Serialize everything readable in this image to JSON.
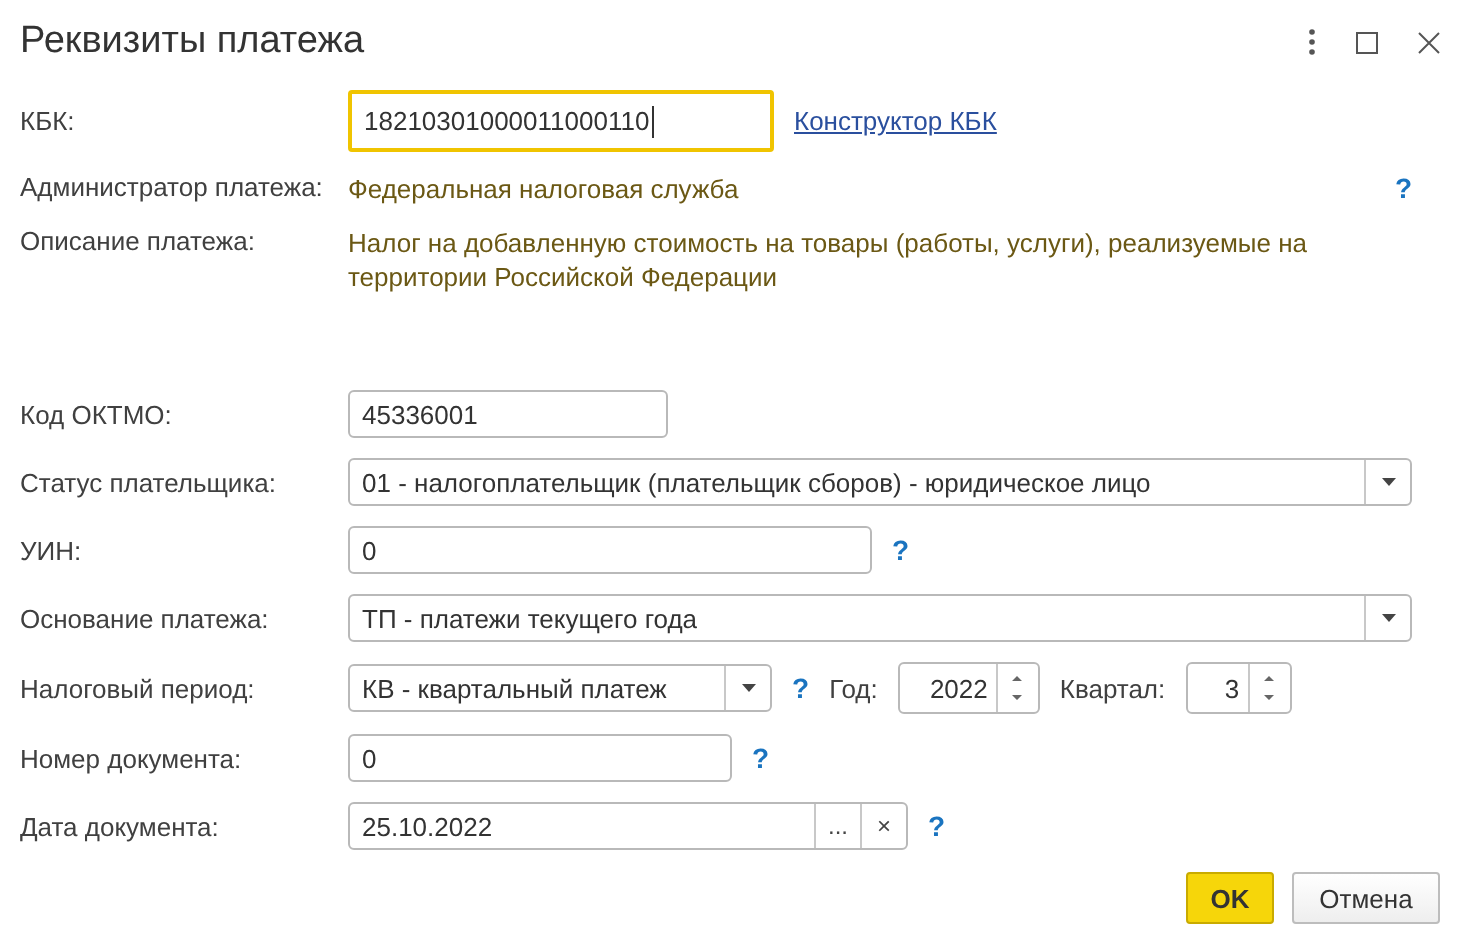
{
  "window": {
    "title": "Реквизиты платежа"
  },
  "fields": [
    {
      "kind": "input",
      "label": "КБК:",
      "value": "18210301000011000110",
      "focused": true,
      "link": "Конструктор КБК"
    },
    {
      "kind": "static",
      "label": "Администратор платежа:",
      "value": "Федеральная налоговая служба",
      "help": "?"
    },
    {
      "kind": "static",
      "label": "Описание платежа:",
      "value": "Налог на добавленную стоимость на товары (работы, услуги), реализуемые на территории Российской Федерации"
    },
    {
      "kind": "input",
      "label": "Код ОКТМО:",
      "value": "45336001",
      "focused": false
    },
    {
      "kind": "select",
      "label": "Статус плательщика:",
      "value": "01 - налогоплательщик (плательщик сборов) - юридическое лицо"
    },
    {
      "kind": "input",
      "label": "УИН:",
      "value": "0",
      "focused": false,
      "help": "?"
    },
    {
      "kind": "select",
      "label": "Основание платежа:",
      "value": "ТП - платежи текущего года"
    },
    {
      "kind": "period",
      "label": "Налоговый период:",
      "value": "КВ - квартальный платеж",
      "help": "?",
      "year_label": "Год:",
      "year": "2022",
      "quarter_label": "Квартал:",
      "quarter": "3"
    },
    {
      "kind": "input",
      "label": "Номер документа:",
      "value": "0",
      "focused": false,
      "help": "?"
    },
    {
      "kind": "date",
      "label": "Дата документа:",
      "value": "25.10.2022",
      "browse": "...",
      "clear": "×",
      "help": "?"
    }
  ],
  "buttons": [
    {
      "label": "OK",
      "default": true
    },
    {
      "label": "Отмена",
      "default": false
    }
  ]
}
